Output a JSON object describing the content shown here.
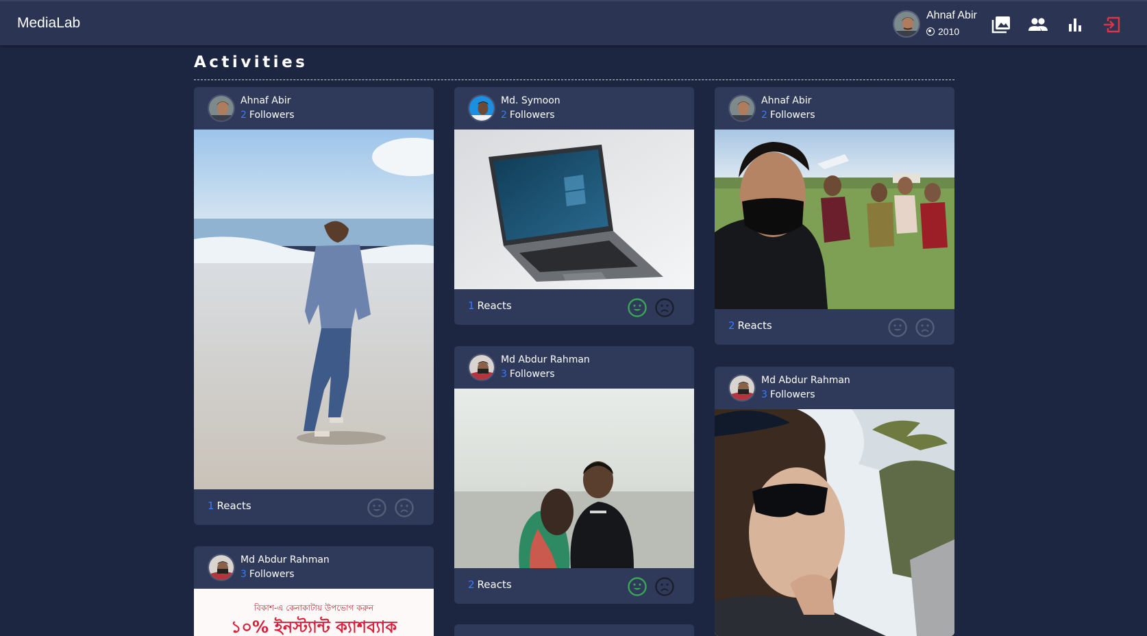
{
  "app": {
    "brand": "MediaLab"
  },
  "user": {
    "name": "Ahnaf Abir",
    "points": "2010"
  },
  "nav_icons": [
    "gallery-icon",
    "people-icon",
    "bar-chart-icon",
    "logout-icon"
  ],
  "colors": {
    "background": "#1d2640",
    "navbar": "#2b3553",
    "card": "#2f3a5a",
    "accent_blue": "#3a7bff",
    "happy_active": "#3aa655",
    "icon_muted": "#555f78",
    "logout": "#e0334a"
  },
  "page": {
    "title": "Activities"
  },
  "posts": [
    {
      "author": "Ahnaf Abir",
      "followers": "2",
      "followers_label": "Followers",
      "reacts": "1",
      "reacts_label": "Reacts",
      "happy_selected": false,
      "image": "man walking on beach"
    },
    {
      "author": "Md. Symoon",
      "followers": "2",
      "followers_label": "Followers",
      "reacts": "1",
      "reacts_label": "Reacts",
      "happy_selected": true,
      "image": "laptop on white background"
    },
    {
      "author": "Ahnaf Abir",
      "followers": "2",
      "followers_label": "Followers",
      "reacts": "2",
      "reacts_label": "Reacts",
      "happy_selected": false,
      "image": "group of friends selfie in field"
    },
    {
      "author": "Md Abdur Rahman",
      "followers": "3",
      "followers_label": "Followers",
      "reacts": "2",
      "reacts_label": "Reacts",
      "happy_selected": true,
      "image": "couple sitting by the sea"
    },
    {
      "author": "Md Abdur Rahman",
      "followers": "3",
      "followers_label": "Followers",
      "image": "man with sunglasses selfie"
    },
    {
      "author": "Md Abdur Rahman",
      "followers": "3",
      "followers_label": "Followers",
      "image": "promotional banner",
      "banner_line1": "বিকাশ-এ কেনাকাটায় উপভোগ করুন",
      "banner_line2": "১০% ইনস্ট্যান্ট ক্যাশব্যাক"
    }
  ]
}
